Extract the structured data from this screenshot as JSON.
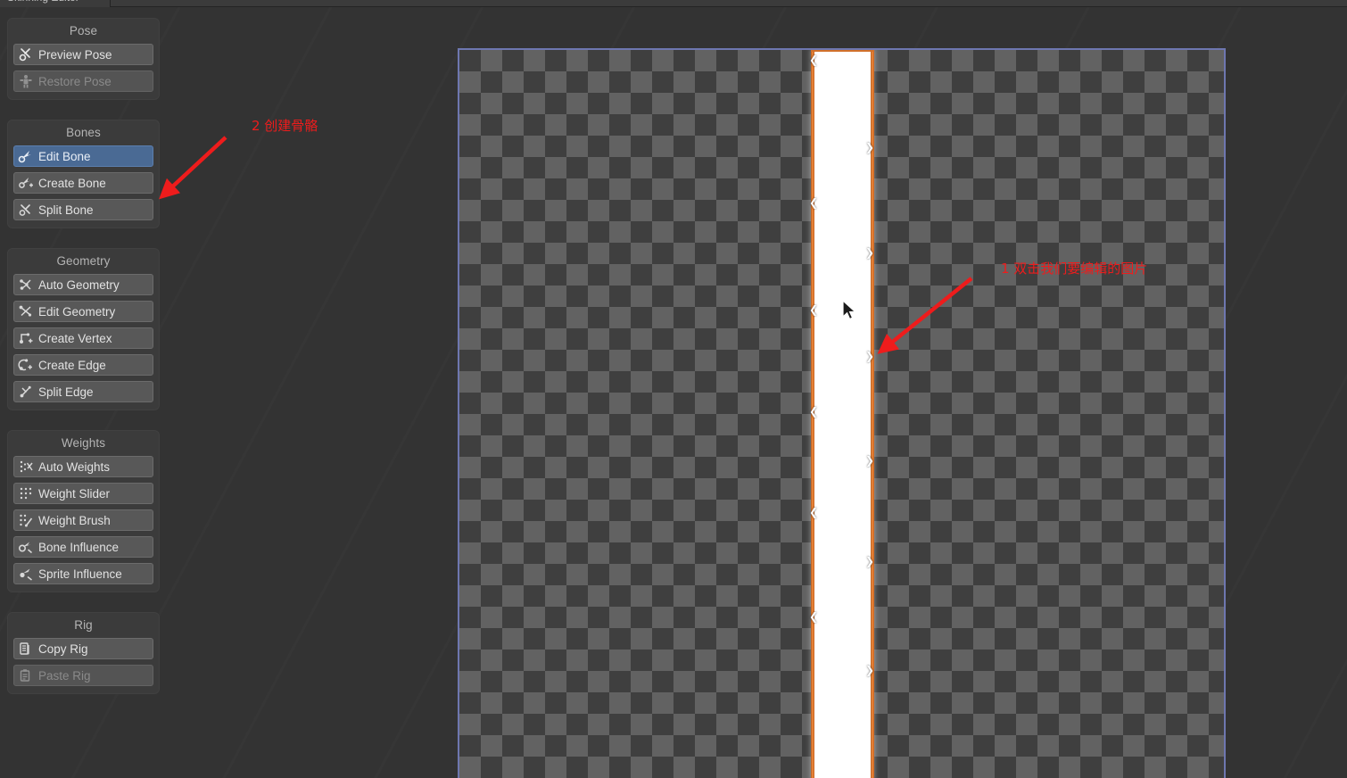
{
  "window": {
    "tab_title": "Skinning Editor",
    "background_color": "#333333"
  },
  "sidebar": {
    "groups": [
      {
        "title": "Pose",
        "items": [
          {
            "label": "Preview Pose",
            "icon": "bone-preview-icon",
            "state": "normal"
          },
          {
            "label": "Restore Pose",
            "icon": "figure-restore-icon",
            "state": "disabled"
          }
        ]
      },
      {
        "title": "Bones",
        "items": [
          {
            "label": "Edit Bone",
            "icon": "bone-edit-icon",
            "state": "active"
          },
          {
            "label": "Create Bone",
            "icon": "bone-create-icon",
            "state": "normal"
          },
          {
            "label": "Split Bone",
            "icon": "bone-split-icon",
            "state": "normal"
          }
        ]
      },
      {
        "title": "Geometry",
        "items": [
          {
            "label": "Auto Geometry",
            "icon": "auto-geometry-icon",
            "state": "normal"
          },
          {
            "label": "Edit Geometry",
            "icon": "edit-geometry-icon",
            "state": "normal"
          },
          {
            "label": "Create Vertex",
            "icon": "create-vertex-icon",
            "state": "normal"
          },
          {
            "label": "Create Edge",
            "icon": "create-edge-icon",
            "state": "normal"
          },
          {
            "label": "Split Edge",
            "icon": "split-edge-icon",
            "state": "normal"
          }
        ]
      },
      {
        "title": "Weights",
        "items": [
          {
            "label": "Auto Weights",
            "icon": "auto-weights-icon",
            "state": "normal"
          },
          {
            "label": "Weight Slider",
            "icon": "weight-slider-icon",
            "state": "normal"
          },
          {
            "label": "Weight Brush",
            "icon": "weight-brush-icon",
            "state": "normal"
          },
          {
            "label": "Bone Influence",
            "icon": "bone-influence-icon",
            "state": "normal"
          },
          {
            "label": "Sprite Influence",
            "icon": "sprite-influence-icon",
            "state": "normal"
          }
        ]
      },
      {
        "title": "Rig",
        "items": [
          {
            "label": "Copy Rig",
            "icon": "copy-rig-icon",
            "state": "normal"
          },
          {
            "label": "Paste Rig",
            "icon": "paste-rig-icon",
            "state": "disabled"
          }
        ]
      }
    ]
  },
  "canvas": {
    "border_color": "#6e77b0",
    "checker_dark": "#3f3f3f",
    "checker_light": "#626262",
    "sprite": {
      "name": "sprite-strip",
      "fill_color": "#ffffff",
      "selection_color": "#ef8a3c"
    }
  },
  "annotations": {
    "color": "#ee1c1c",
    "items": [
      {
        "id": "anno-create-bone",
        "text": "2 创建骨骼"
      },
      {
        "id": "anno-double-click-image",
        "text": "1 双击我们要编辑的图片"
      }
    ]
  }
}
